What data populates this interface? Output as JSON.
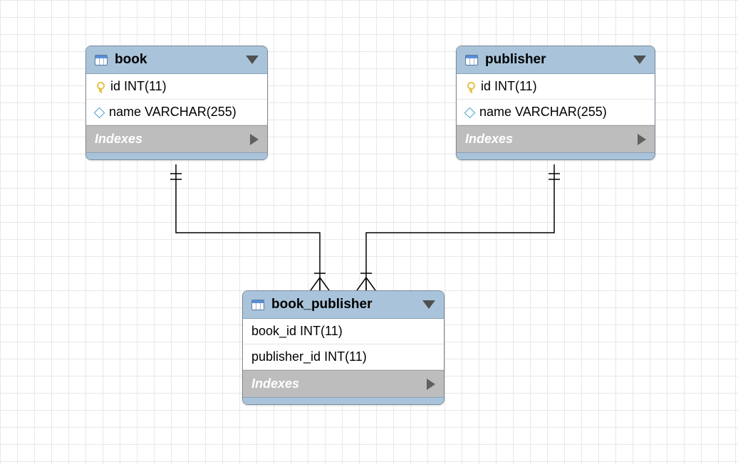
{
  "entities": {
    "book": {
      "title": "book",
      "columns": [
        {
          "icon": "key",
          "text": "id INT(11)"
        },
        {
          "icon": "diamond",
          "text": "name VARCHAR(255)"
        }
      ],
      "indexes_label": "Indexes"
    },
    "publisher": {
      "title": "publisher",
      "columns": [
        {
          "icon": "key",
          "text": "id INT(11)"
        },
        {
          "icon": "diamond",
          "text": "name VARCHAR(255)"
        }
      ],
      "indexes_label": "Indexes"
    },
    "book_publisher": {
      "title": "book_publisher",
      "columns": [
        {
          "icon": "",
          "text": "book_id INT(11)"
        },
        {
          "icon": "",
          "text": "publisher_id INT(11)"
        }
      ],
      "indexes_label": "Indexes"
    }
  },
  "relationships": [
    {
      "from": "book",
      "to": "book_publisher",
      "from_card": "one",
      "to_card": "many"
    },
    {
      "from": "publisher",
      "to": "book_publisher",
      "from_card": "one",
      "to_card": "many"
    }
  ]
}
